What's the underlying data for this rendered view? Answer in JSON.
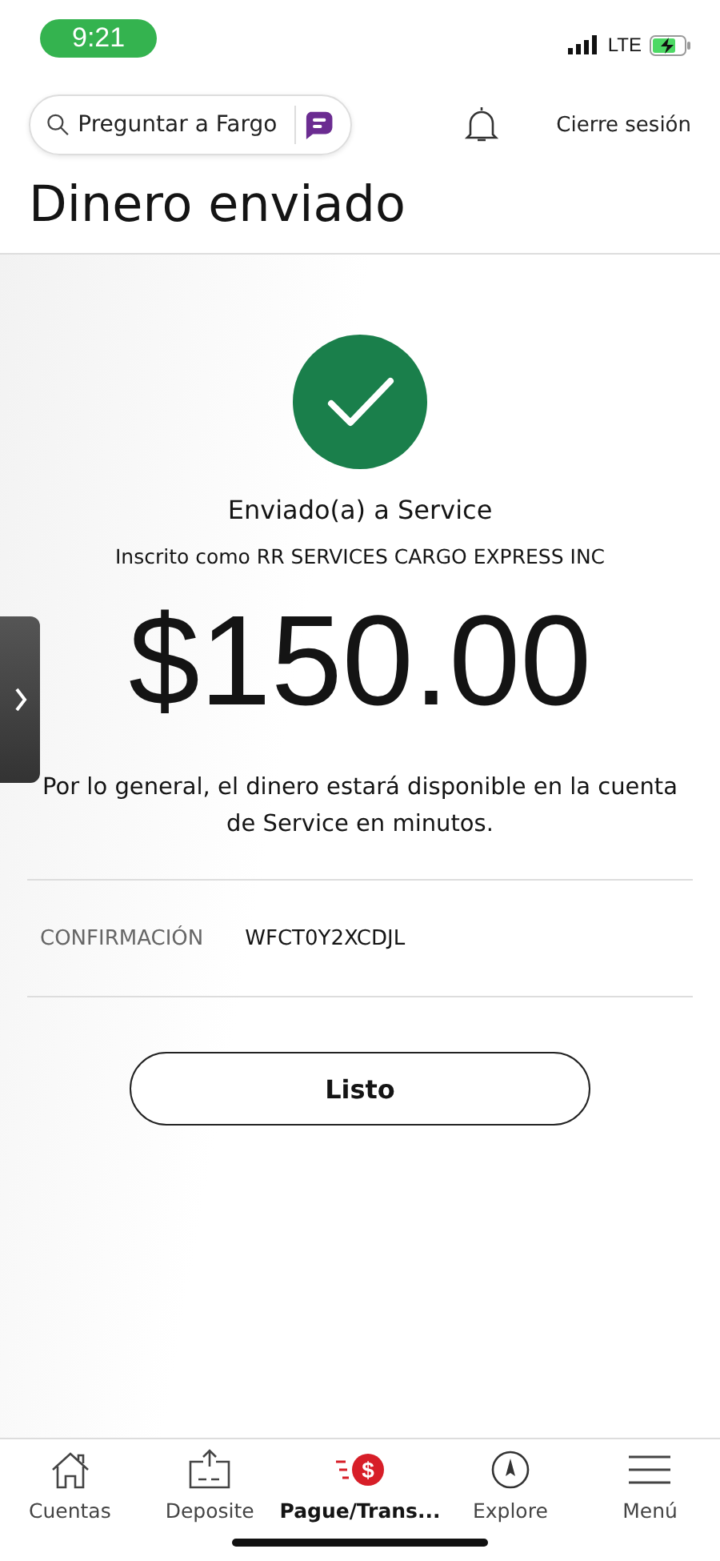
{
  "status_bar": {
    "time": "9:21",
    "network": "LTE"
  },
  "header": {
    "search": {
      "placeholder": "Preguntar a Fargo"
    },
    "logout": "Cierre sesión"
  },
  "title": "Dinero enviado",
  "result": {
    "heading": "Enviado(a) a Service",
    "subheading": "Inscrito como RR SERVICES CARGO EXPRESS INC",
    "amount": "$150.00",
    "note": "Por lo general, el dinero estará disponible en la cuenta de Service en minutos."
  },
  "confirmation": {
    "label": "CONFIRMACIÓN",
    "value": "WFCT0Y2XCDJL"
  },
  "done_button": "Listo",
  "tabs": [
    {
      "kind": "home",
      "label": "Cuentas",
      "selected": false
    },
    {
      "kind": "deposit",
      "label": "Deposite",
      "selected": false
    },
    {
      "kind": "pay",
      "icon_text": "$",
      "label": "Pague/Trans...",
      "selected": true
    },
    {
      "kind": "explore",
      "label": "Explore",
      "selected": false
    },
    {
      "kind": "menu",
      "label": "Menú",
      "selected": false
    }
  ]
}
